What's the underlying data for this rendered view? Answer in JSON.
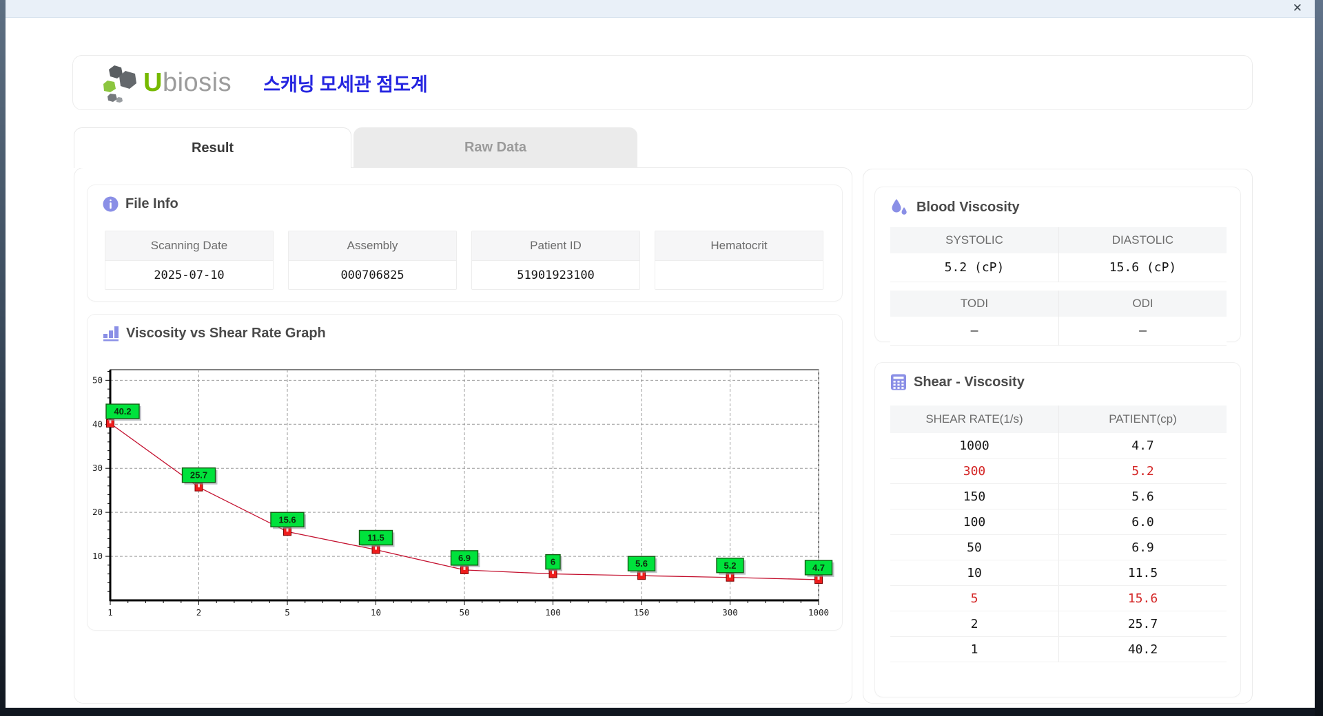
{
  "window": {
    "close_glyph": "✕"
  },
  "header": {
    "logo_u": "U",
    "logo_rest": "biosis",
    "app_title": "스캐닝 모세관 점도계"
  },
  "tabs": [
    {
      "label": "Result",
      "active": true
    },
    {
      "label": "Raw Data",
      "active": false
    }
  ],
  "file_info": {
    "title": "File Info",
    "fields": [
      {
        "label": "Scanning Date",
        "value": "2025-07-10"
      },
      {
        "label": "Assembly",
        "value": "000706825"
      },
      {
        "label": "Patient ID",
        "value": "51901923100"
      },
      {
        "label": "Hematocrit",
        "value": ""
      }
    ]
  },
  "blood_viscosity": {
    "title": "Blood Viscosity",
    "groups": [
      {
        "headers": [
          "SYSTOLIC",
          "DIASTOLIC"
        ],
        "values": [
          "5.2 (cP)",
          "15.6 (cP)"
        ]
      },
      {
        "headers": [
          "TODI",
          "ODI"
        ],
        "values": [
          "–",
          "–"
        ]
      }
    ]
  },
  "graph": {
    "title": "Viscosity vs Shear Rate Graph"
  },
  "chart_data": {
    "type": "line",
    "title": "Viscosity vs Shear Rate Graph",
    "x_scale": "categorical",
    "categories": [
      "1",
      "2",
      "5",
      "10",
      "50",
      "100",
      "150",
      "300",
      "1000"
    ],
    "values": [
      40.2,
      25.7,
      15.6,
      11.5,
      6.9,
      6,
      5.6,
      5.2,
      4.7
    ],
    "point_labels": [
      "40.2",
      "25.7",
      "15.6",
      "11.5",
      "6.9",
      "6",
      "5.6",
      "5.2",
      "4.7"
    ],
    "xlabel": "",
    "ylabel": "",
    "ylim": [
      0,
      52.4
    ],
    "yticks": [
      10,
      20,
      30,
      40,
      50
    ],
    "grid": "dashed",
    "legend": "none",
    "colors": {
      "line": "#c41230",
      "marker_fill": "#ee1c1c",
      "marker_stroke": "#7d0000",
      "label_bg": "#00e23c",
      "label_border": "#135c13",
      "label_text": "#0d2e0d",
      "grid": "#9a9a9a",
      "axis": "#000000"
    }
  },
  "shear_viscosity": {
    "title": "Shear - Viscosity",
    "columns": [
      "SHEAR RATE(1/s)",
      "PATIENT(cp)"
    ],
    "rows": [
      {
        "shear": "1000",
        "patient": "4.7",
        "highlight": false
      },
      {
        "shear": "300",
        "patient": "5.2",
        "highlight": true
      },
      {
        "shear": "150",
        "patient": "5.6",
        "highlight": false
      },
      {
        "shear": "100",
        "patient": "6.0",
        "highlight": false
      },
      {
        "shear": "50",
        "patient": "6.9",
        "highlight": false
      },
      {
        "shear": "10",
        "patient": "11.5",
        "highlight": false
      },
      {
        "shear": "5",
        "patient": "15.6",
        "highlight": true
      },
      {
        "shear": "2",
        "patient": "25.7",
        "highlight": false
      },
      {
        "shear": "1",
        "patient": "40.2",
        "highlight": false
      }
    ]
  },
  "accent_colors": {
    "icon_purple": "#8a8fe6",
    "highlight_red": "#d42626",
    "title_blue": "#2525e0",
    "logo_green": "#76b900"
  }
}
